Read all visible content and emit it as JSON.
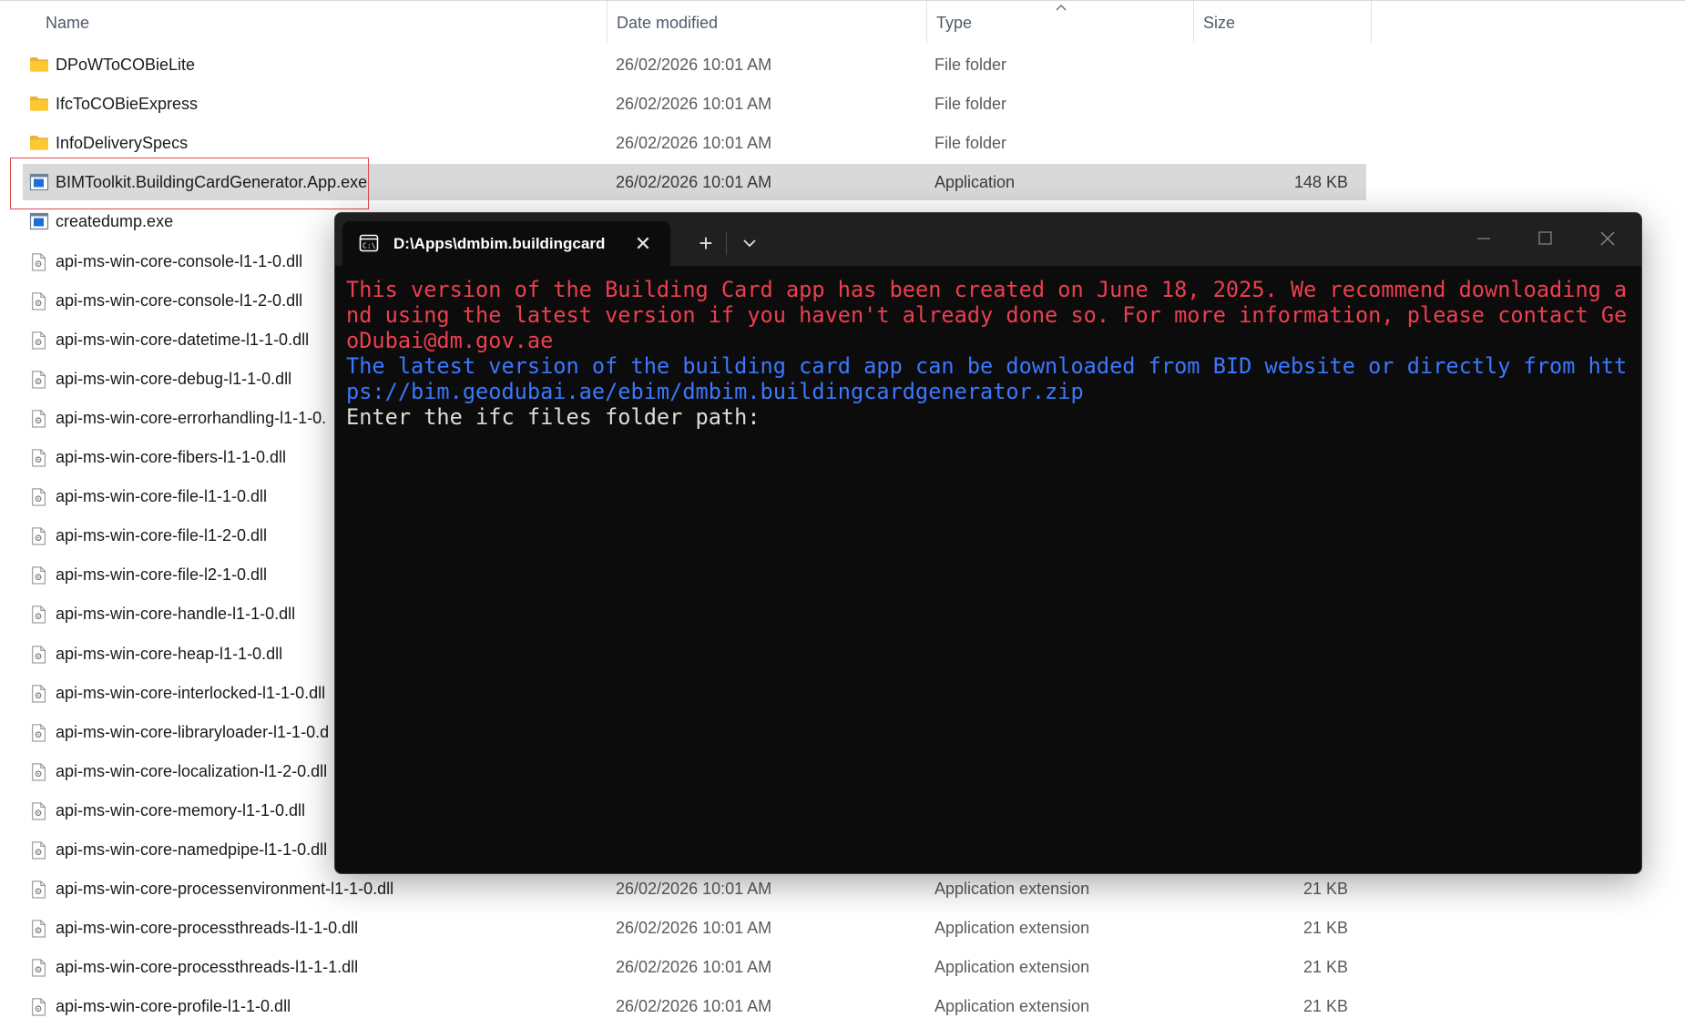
{
  "explorer": {
    "columns": {
      "name": "Name",
      "date": "Date modified",
      "type": "Type",
      "size": "Size"
    },
    "sort_indicator": "^",
    "files": [
      {
        "name": "DPoWToCOBieLite",
        "date": "26/02/2026 10:01 AM",
        "type": "File folder",
        "size": "",
        "icon": "folder-icon"
      },
      {
        "name": "IfcToCOBieExpress",
        "date": "26/02/2026 10:01 AM",
        "type": "File folder",
        "size": "",
        "icon": "folder-icon"
      },
      {
        "name": "InfoDeliverySpecs",
        "date": "26/02/2026 10:01 AM",
        "type": "File folder",
        "size": "",
        "icon": "folder-icon"
      },
      {
        "name": "BIMToolkit.BuildingCardGenerator.App.exe",
        "date": "26/02/2026 10:01 AM",
        "type": "Application",
        "size": "148 KB",
        "icon": "exe-icon",
        "selected": true
      },
      {
        "name": "createdump.exe",
        "date": "",
        "type": "",
        "size": "",
        "icon": "exe-icon"
      },
      {
        "name": "api-ms-win-core-console-l1-1-0.dll",
        "date": "",
        "type": "",
        "size": "",
        "icon": "dll-icon"
      },
      {
        "name": "api-ms-win-core-console-l1-2-0.dll",
        "date": "",
        "type": "",
        "size": "",
        "icon": "dll-icon"
      },
      {
        "name": "api-ms-win-core-datetime-l1-1-0.dll",
        "date": "",
        "type": "",
        "size": "",
        "icon": "dll-icon"
      },
      {
        "name": "api-ms-win-core-debug-l1-1-0.dll",
        "date": "",
        "type": "",
        "size": "",
        "icon": "dll-icon"
      },
      {
        "name": "api-ms-win-core-errorhandling-l1-1-0.",
        "date": "",
        "type": "",
        "size": "",
        "icon": "dll-icon"
      },
      {
        "name": "api-ms-win-core-fibers-l1-1-0.dll",
        "date": "",
        "type": "",
        "size": "",
        "icon": "dll-icon"
      },
      {
        "name": "api-ms-win-core-file-l1-1-0.dll",
        "date": "",
        "type": "",
        "size": "",
        "icon": "dll-icon"
      },
      {
        "name": "api-ms-win-core-file-l1-2-0.dll",
        "date": "",
        "type": "",
        "size": "",
        "icon": "dll-icon"
      },
      {
        "name": "api-ms-win-core-file-l2-1-0.dll",
        "date": "",
        "type": "",
        "size": "",
        "icon": "dll-icon"
      },
      {
        "name": "api-ms-win-core-handle-l1-1-0.dll",
        "date": "",
        "type": "",
        "size": "",
        "icon": "dll-icon"
      },
      {
        "name": "api-ms-win-core-heap-l1-1-0.dll",
        "date": "",
        "type": "",
        "size": "",
        "icon": "dll-icon"
      },
      {
        "name": "api-ms-win-core-interlocked-l1-1-0.dll",
        "date": "",
        "type": "",
        "size": "",
        "icon": "dll-icon"
      },
      {
        "name": "api-ms-win-core-libraryloader-l1-1-0.d",
        "date": "",
        "type": "",
        "size": "",
        "icon": "dll-icon"
      },
      {
        "name": "api-ms-win-core-localization-l1-2-0.dll",
        "date": "",
        "type": "",
        "size": "",
        "icon": "dll-icon"
      },
      {
        "name": "api-ms-win-core-memory-l1-1-0.dll",
        "date": "",
        "type": "",
        "size": "",
        "icon": "dll-icon"
      },
      {
        "name": "api-ms-win-core-namedpipe-l1-1-0.dll",
        "date": "",
        "type": "",
        "size": "",
        "icon": "dll-icon"
      },
      {
        "name": "api-ms-win-core-processenvironment-l1-1-0.dll",
        "date": "26/02/2026 10:01 AM",
        "type": "Application extension",
        "size": "21 KB",
        "icon": "dll-icon"
      },
      {
        "name": "api-ms-win-core-processthreads-l1-1-0.dll",
        "date": "26/02/2026 10:01 AM",
        "type": "Application extension",
        "size": "21 KB",
        "icon": "dll-icon"
      },
      {
        "name": "api-ms-win-core-processthreads-l1-1-1.dll",
        "date": "26/02/2026 10:01 AM",
        "type": "Application extension",
        "size": "21 KB",
        "icon": "dll-icon"
      },
      {
        "name": "api-ms-win-core-profile-l1-1-0.dll",
        "date": "26/02/2026 10:01 AM",
        "type": "Application extension",
        "size": "21 KB",
        "icon": "dll-icon"
      }
    ]
  },
  "terminal": {
    "tab_title": "D:\\Apps\\dmbim.buildingcard",
    "tab_icon": "terminal-icon",
    "close_glyph": "✕",
    "new_tab_glyph": "+",
    "lines": [
      {
        "text": "This version of the Building Card app has been created on June 18, 2025. We recommend downloading a",
        "color": "red"
      },
      {
        "text": "nd using the latest version if you haven't already done so. For more information, please contact Ge",
        "color": "red"
      },
      {
        "text": "oDubai@dm.gov.ae",
        "color": "red"
      },
      {
        "text": "The latest version of the building card app can be downloaded from BID website or directly from htt",
        "color": "blue"
      },
      {
        "text": "ps://bim.geodubai.ae/ebim/dmbim.buildingcardgenerator.zip",
        "color": "blue"
      },
      {
        "text": "Enter the ifc files folder path:",
        "color": "white"
      }
    ]
  },
  "colors": {
    "selection": "#d9d9d9",
    "highlight_border": "#e0484a",
    "terminal_bg": "#0c0c0c",
    "warning_text": "#ec3f4f",
    "info_text": "#3b78ff",
    "prompt_text": "#dcdcdc"
  }
}
